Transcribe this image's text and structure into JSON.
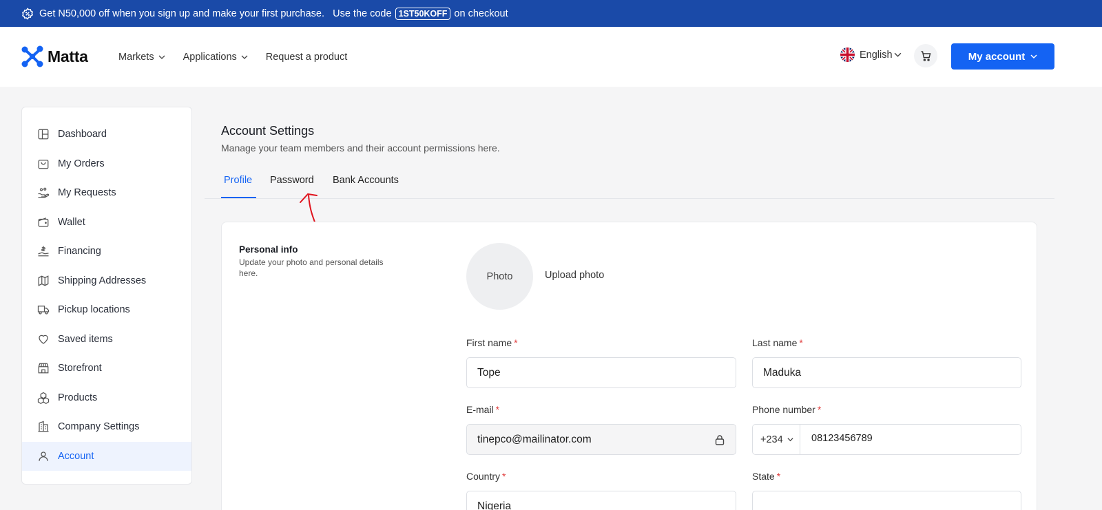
{
  "promo": {
    "text_before": "Get N50,000 off when you sign up and make your first purchase.   Use the code",
    "code": "1ST50KOFF",
    "text_after": "on checkout"
  },
  "header": {
    "logo": "Matta",
    "nav": [
      {
        "label": "Markets",
        "has_dropdown": true
      },
      {
        "label": "Applications",
        "has_dropdown": true
      },
      {
        "label": "Request a product",
        "has_dropdown": false
      }
    ],
    "language": "English",
    "account_button": "My account"
  },
  "sidebar": {
    "items": [
      {
        "label": "Dashboard",
        "icon": "dashboard-icon"
      },
      {
        "label": "My Orders",
        "icon": "shopping-bag-icon"
      },
      {
        "label": "My Requests",
        "icon": "requests-icon"
      },
      {
        "label": "Wallet",
        "icon": "wallet-icon"
      },
      {
        "label": "Financing",
        "icon": "financing-icon"
      },
      {
        "label": "Shipping Addresses",
        "icon": "map-icon"
      },
      {
        "label": "Pickup locations",
        "icon": "truck-icon"
      },
      {
        "label": "Saved items",
        "icon": "heart-icon"
      },
      {
        "label": "Storefront",
        "icon": "storefront-icon"
      },
      {
        "label": "Products",
        "icon": "boxes-icon"
      },
      {
        "label": "Company Settings",
        "icon": "building-icon"
      },
      {
        "label": "Account",
        "icon": "user-icon",
        "active": true
      }
    ]
  },
  "main": {
    "title": "Account Settings",
    "subtitle": "Manage your team members and their account permissions here.",
    "tabs": [
      {
        "label": "Profile",
        "active": true
      },
      {
        "label": "Password",
        "active": false
      },
      {
        "label": "Bank Accounts",
        "active": false
      }
    ],
    "personal_info": {
      "title": "Personal info",
      "subtitle": "Update your photo and personal details here.",
      "photo_placeholder": "Photo",
      "upload_label": "Upload photo"
    },
    "fields": {
      "first_name": {
        "label": "First name",
        "required": "*",
        "value": "Tope"
      },
      "last_name": {
        "label": "Last name",
        "required": "*",
        "value": "Maduka"
      },
      "email": {
        "label": "E-mail",
        "required": "*",
        "value": "tinepco@mailinator.com"
      },
      "phone": {
        "label": "Phone number",
        "required": "*",
        "code": "+234",
        "value": "08123456789"
      },
      "country": {
        "label": "Country",
        "required": "*",
        "value": "Nigeria"
      },
      "state": {
        "label": "State",
        "required": "*",
        "value": ""
      }
    }
  },
  "colors": {
    "promo_bg": "#1a4aa8",
    "accent": "#1463f3",
    "annotation": "#e0141e"
  }
}
